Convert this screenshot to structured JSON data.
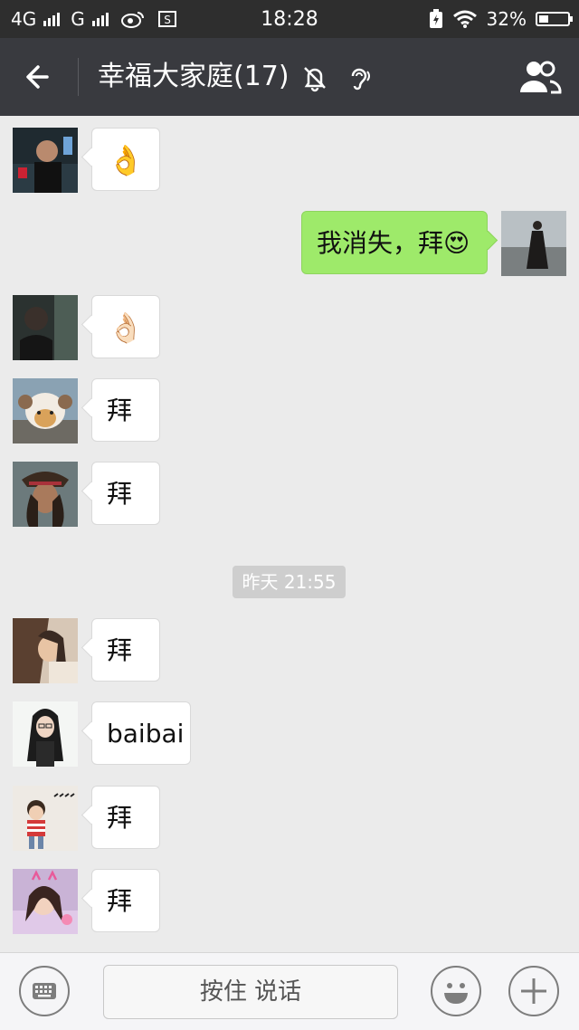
{
  "status_bar": {
    "network1": "4G",
    "network2": "G",
    "time": "18:28",
    "battery_percent": "32%",
    "battery_level": 0.32
  },
  "header": {
    "title": "幸福大家庭(17)"
  },
  "messages": [
    {
      "dir": "in",
      "text": "👌",
      "kind": "emoji"
    },
    {
      "dir": "out",
      "text": "我消失，拜😍",
      "kind": "text"
    },
    {
      "dir": "in",
      "text": "👌🏻",
      "kind": "emoji"
    },
    {
      "dir": "in",
      "text": "拜",
      "kind": "text"
    },
    {
      "dir": "in",
      "text": "拜",
      "kind": "text"
    },
    {
      "dir": "in",
      "text": "拜",
      "kind": "text"
    },
    {
      "dir": "in",
      "text": "baibai",
      "kind": "text"
    },
    {
      "dir": "in",
      "text": "拜",
      "kind": "text"
    },
    {
      "dir": "in",
      "text": "拜",
      "kind": "text"
    }
  ],
  "timestamp": "昨天 21:55",
  "input": {
    "hold_to_talk": "按住 说话"
  },
  "colors": {
    "status_bg": "#2e2e2e",
    "header_bg": "#393a3f",
    "chat_bg": "#ebebeb",
    "out_bubble": "#9eea6a",
    "in_bubble": "#ffffff"
  }
}
